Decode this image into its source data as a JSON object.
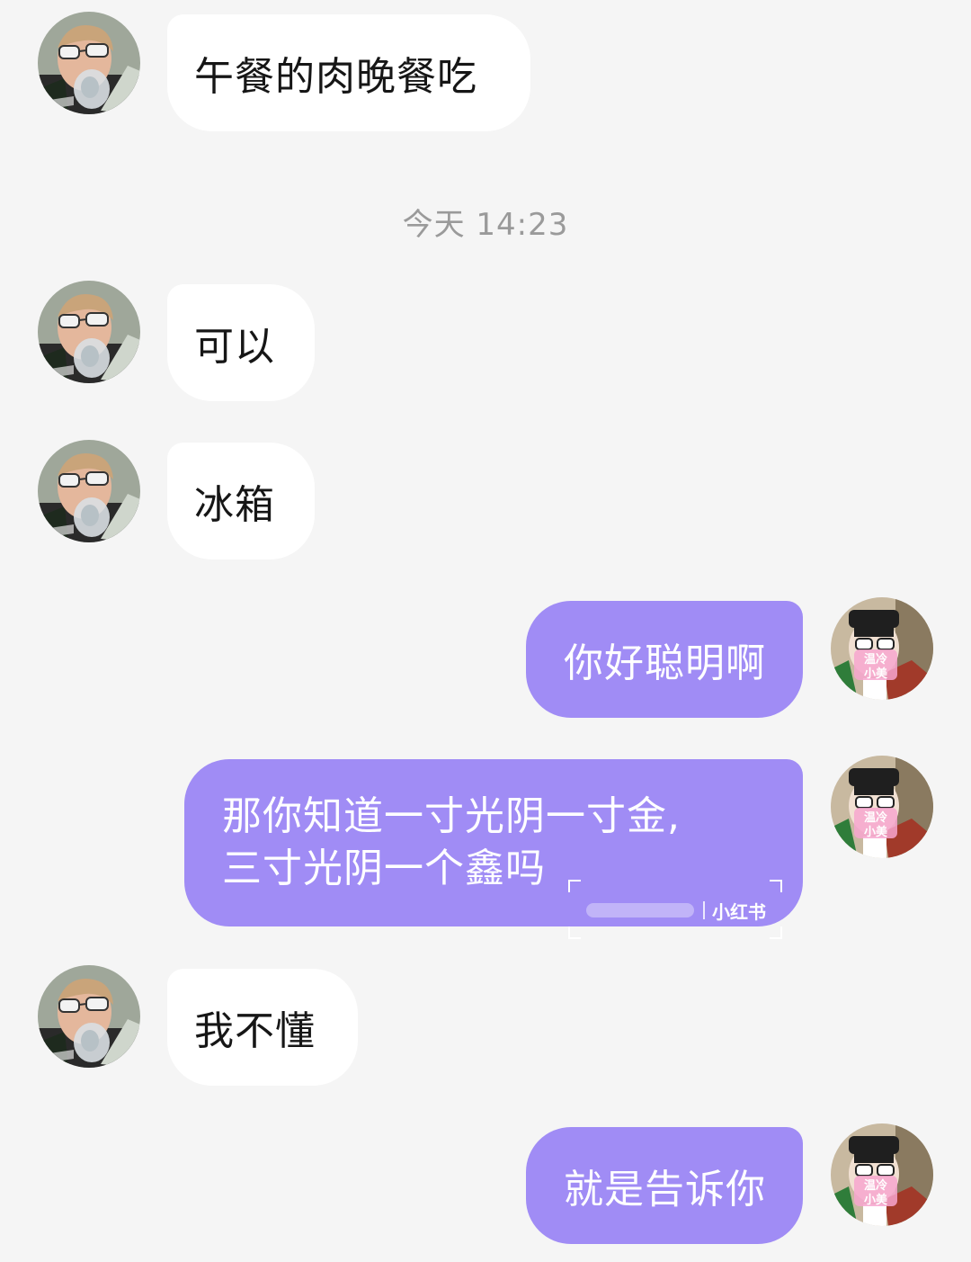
{
  "chat": {
    "messages": [
      {
        "text": "午餐的肉晚餐吃"
      },
      {
        "text": "可以"
      },
      {
        "text": "冰箱"
      },
      {
        "text": "你好聪明啊"
      },
      {
        "line1": "那你知道一寸光阴一寸金,",
        "line2": "三寸光阴一个鑫吗"
      },
      {
        "text": "我不懂"
      },
      {
        "text": "就是告诉你"
      }
    ],
    "timestamp": "今天 14:23"
  },
  "avatars": {
    "contact_icon": "avatar-photo-glasses",
    "self_icon": "avatar-photo-sticker",
    "self_sticker_text": "温冷小美"
  },
  "watermark": {
    "brand": "小红书"
  },
  "colors": {
    "background": "#f5f5f5",
    "incoming_bubble": "#ffffff",
    "outgoing_bubble": "#a08cf5",
    "timestamp_text": "#9a9a9a"
  }
}
